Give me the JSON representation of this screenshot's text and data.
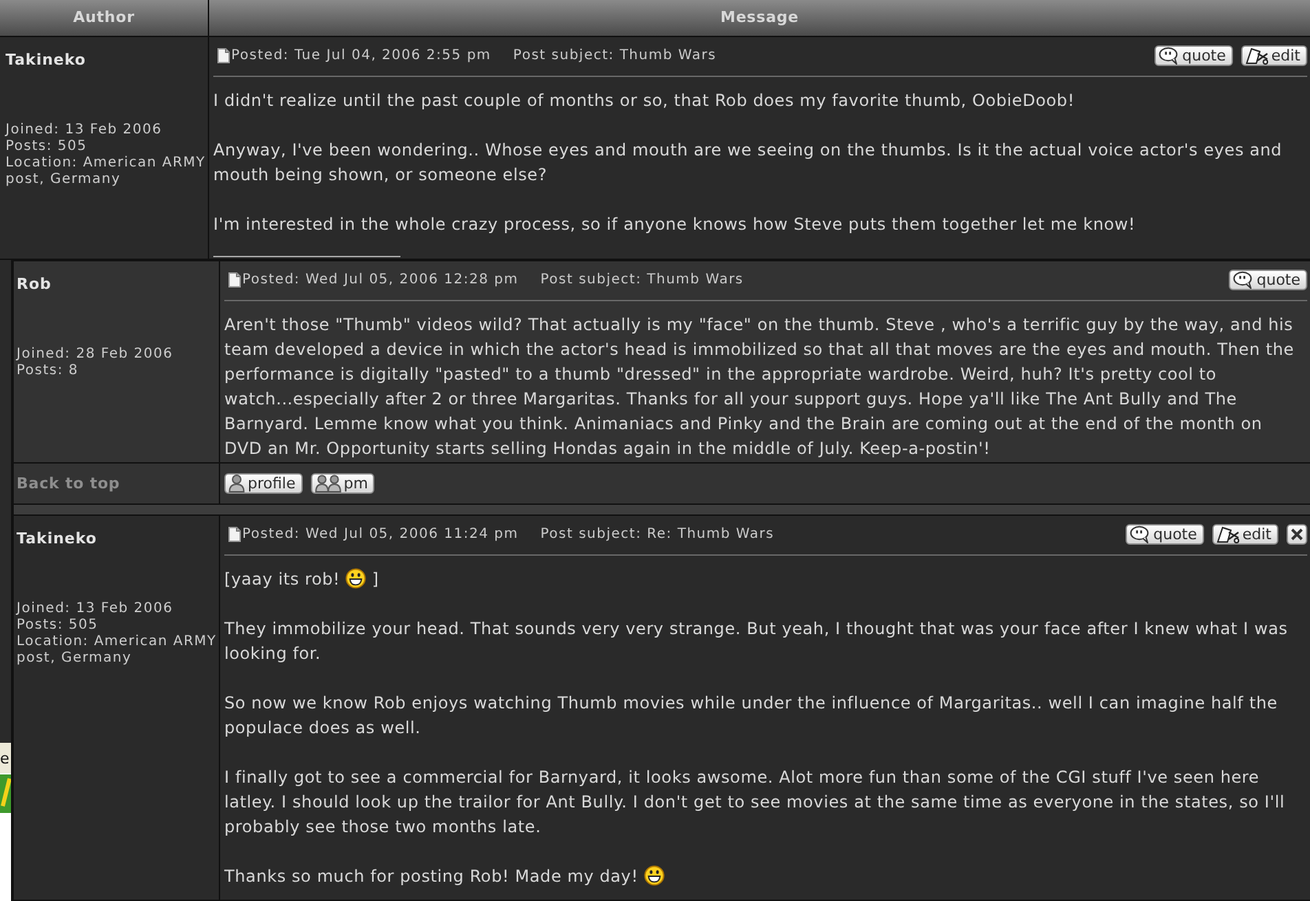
{
  "table": {
    "columns": [
      "Author",
      "Message"
    ]
  },
  "posts": [
    {
      "author": "Takineko",
      "details": [
        "Joined: 13 Feb 2006",
        "Posts: 505",
        "Location: American ARMY post, Germany"
      ],
      "posted": "Posted: Tue Jul 04, 2006 2:55 pm",
      "subject": "Post subject: Thumb Wars",
      "actions": [
        {
          "kind": "quote",
          "label": "quote"
        },
        {
          "kind": "edit",
          "label": "edit"
        }
      ],
      "body": [
        [
          {
            "kind": "text",
            "text": "I didn't realize until the past couple of months or so, that Rob does my favorite thumb, OobieDoob!"
          }
        ],
        [
          {
            "kind": "text",
            "text": "Anyway, I've been wondering.. Whose eyes and mouth are we seeing on the thumbs. Is it the actual voice actor's eyes and mouth being shown, or someone else?"
          }
        ],
        [
          {
            "kind": "text",
            "text": "I'm interested in the whole crazy process, so if anyone knows how Steve puts them together let me know!"
          }
        ]
      ],
      "signature": true
    },
    {
      "author": "Rob",
      "details": [
        "Joined: 28 Feb 2006",
        "Posts: 8"
      ],
      "posted": "Posted: Wed Jul 05, 2006 12:28 pm",
      "subject": "Post subject: Thumb Wars",
      "actions": [
        {
          "kind": "quote",
          "label": "quote"
        }
      ],
      "body": [
        [
          {
            "kind": "text",
            "text": "Aren't those \"Thumb\" videos wild? That actually is my \"face\" on the thumb. Steve , who's a terrific guy by the way, and his team developed a device in which the actor's head is immobilized so that all that moves are the eyes and mouth. Then the performance is digitally \"pasted\" to a thumb \"dressed\" in the appropriate wardrobe. Weird, huh? It's pretty cool to watch...especially after 2 or three Margaritas. Thanks for all your support guys. Hope ya'll like The Ant Bully and The Barnyard. Lemme know what you think. Animaniacs and Pinky and the Brain are coming out at the end of the month on DVD an Mr. Opportunity starts selling Hondas again in the middle of July. Keep-a-postin'!"
          }
        ]
      ],
      "footer": {
        "back_to_top": "Back to top",
        "buttons": [
          {
            "kind": "profile",
            "label": "profile"
          },
          {
            "kind": "pm",
            "label": "pm"
          }
        ]
      }
    },
    {
      "author": "Takineko",
      "details": [
        "Joined: 13 Feb 2006",
        "Posts: 505",
        "Location: American ARMY post, Germany"
      ],
      "posted": "Posted: Wed Jul 05, 2006 11:24 pm",
      "subject": "Post subject: Re: Thumb Wars",
      "actions": [
        {
          "kind": "quote",
          "label": "quote"
        },
        {
          "kind": "edit",
          "label": "edit"
        },
        {
          "kind": "delete"
        }
      ],
      "body": [
        [
          {
            "kind": "text",
            "text": "[yaay its rob! "
          },
          {
            "kind": "smiley"
          },
          {
            "kind": "text",
            "text": " ]"
          }
        ],
        [
          {
            "kind": "text",
            "text": "They immobilize your head. That sounds very very strange. But yeah, I thought that was your face after I knew what I was looking for."
          }
        ],
        [
          {
            "kind": "text",
            "text": "So now we know Rob enjoys watching Thumb movies while under the influence of Margaritas.. well I can imagine half the populace does as well."
          }
        ],
        [
          {
            "kind": "text",
            "text": "I finally got to see a commercial for Barnyard, it looks awsome. Alot more fun than some of the CGI stuff I've seen here latley. I should look up the trailor for Ant Bully. I don't get to see movies at the same time as everyone in the states, so I'll probably see those two months late."
          }
        ],
        [
          {
            "kind": "text",
            "text": "Thanks so much for posting Rob! Made my day! "
          },
          {
            "kind": "smiley"
          }
        ]
      ]
    }
  ],
  "background_window": {
    "text": "e"
  }
}
